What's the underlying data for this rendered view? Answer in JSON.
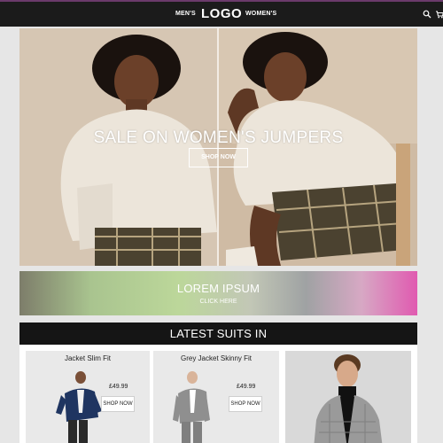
{
  "nav": {
    "mens": "MEN'S",
    "logo": "LOGO",
    "womens": "WOMEN'S",
    "icons": [
      "search-icon",
      "cart-icon"
    ]
  },
  "hero": {
    "title": "SALE ON WOMEN'S JUMPERS",
    "button": "SHOP NOW"
  },
  "promo": {
    "title": "LOREM IPSUM",
    "subtitle": "CLICK HERE"
  },
  "latest": {
    "heading": "LATEST SUITS IN",
    "products": [
      {
        "name": "Jacket Slim Fit",
        "price": "£49.99",
        "button": "SHOP NOW"
      },
      {
        "name": "Grey Jacket Skinny Fit",
        "price": "£49.99",
        "button": "SHOP NOW"
      },
      {
        "name": "",
        "price": "",
        "button": ""
      }
    ]
  },
  "colors": {
    "nav_bg": "#1b1b1b",
    "nav_accent": "#6b3a6b",
    "page_bg": "#e6e6e6",
    "section_head_bg": "#151515",
    "text": "#222222"
  }
}
